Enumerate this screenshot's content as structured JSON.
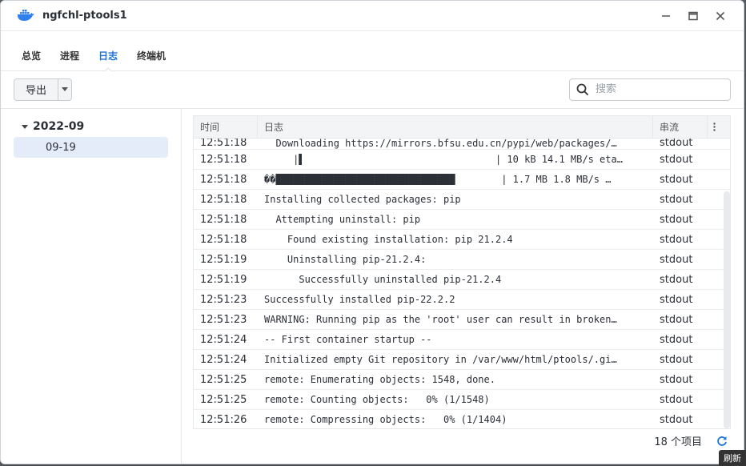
{
  "window": {
    "title": "ngfchl-ptools1",
    "app_icon": "docker-whale-icon",
    "accent": "#1a73d9"
  },
  "tabs": [
    {
      "label": "总览",
      "active": false
    },
    {
      "label": "进程",
      "active": false
    },
    {
      "label": "日志",
      "active": true
    },
    {
      "label": "终端机",
      "active": false
    }
  ],
  "toolbar": {
    "export_label": "导出",
    "search_placeholder": "搜索"
  },
  "sidebar": {
    "year": "2022-09",
    "day": "09-19"
  },
  "table": {
    "columns": [
      "时间",
      "日志",
      "串流"
    ],
    "rows": [
      {
        "time": "12:51:18",
        "log": "  Downloading https://mirrors.bfsu.edu.cn/pypi/web/packages/…",
        "stream": "stdout",
        "partial": true
      },
      {
        "time": "12:51:18",
        "log": "     |▌                                 | 10 kB 14.1 MB/s eta…",
        "stream": "stdout"
      },
      {
        "time": "12:51:18",
        "log": "��███████████████████████████████        | 1.7 MB 1.8 MB/s …",
        "stream": "stdout"
      },
      {
        "time": "12:51:18",
        "log": "Installing collected packages: pip",
        "stream": "stdout"
      },
      {
        "time": "12:51:18",
        "log": "  Attempting uninstall: pip",
        "stream": "stdout"
      },
      {
        "time": "12:51:18",
        "log": "    Found existing installation: pip 21.2.4",
        "stream": "stdout"
      },
      {
        "time": "12:51:19",
        "log": "    Uninstalling pip-21.2.4:",
        "stream": "stdout"
      },
      {
        "time": "12:51:19",
        "log": "      Successfully uninstalled pip-21.2.4",
        "stream": "stdout"
      },
      {
        "time": "12:51:23",
        "log": "Successfully installed pip-22.2.2",
        "stream": "stdout"
      },
      {
        "time": "12:51:23",
        "log": "WARNING: Running pip as the 'root' user can result in broken…",
        "stream": "stdout"
      },
      {
        "time": "12:51:24",
        "log": "-- First container startup --",
        "stream": "stdout"
      },
      {
        "time": "12:51:24",
        "log": "Initialized empty Git repository in /var/www/html/ptools/.gi…",
        "stream": "stdout"
      },
      {
        "time": "12:51:25",
        "log": "remote: Enumerating objects: 1548, done.",
        "stream": "stdout"
      },
      {
        "time": "12:51:25",
        "log": "remote: Counting objects:   0% (1/1548)",
        "stream": "stdout"
      },
      {
        "time": "12:51:26",
        "log": "remote: Compressing objects:   0% (1/1404)",
        "stream": "stdout"
      }
    ]
  },
  "footer": {
    "count_label": "18 个项目"
  },
  "tooltip": "刷新"
}
